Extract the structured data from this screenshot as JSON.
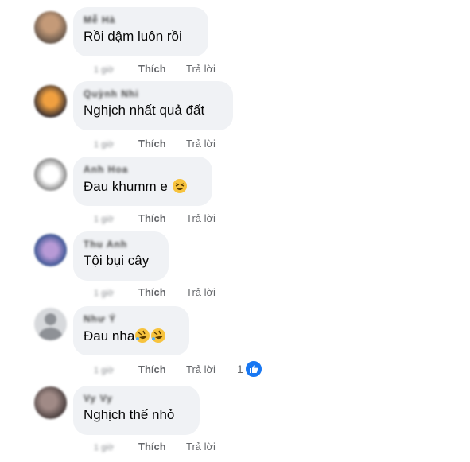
{
  "comments": [
    {
      "name": "Mễ Hà",
      "text": "Rồi dậm luôn rồi",
      "time": "1 giờ",
      "like_label": "Thích",
      "reply_label": "Trả lời"
    },
    {
      "name": "Quỳnh Nhi",
      "text": "Nghịch nhất quả đất",
      "time": "1 giờ",
      "like_label": "Thích",
      "reply_label": "Trả lời"
    },
    {
      "name": "Anh Hoa",
      "text": "Đau khumm e",
      "time": "1 giờ",
      "like_label": "Thích",
      "reply_label": "Trả lời",
      "emoji": "grinning-squint-emoji"
    },
    {
      "name": "Thu Anh",
      "text": "Tội bụi cây",
      "time": "1 giờ",
      "like_label": "Thích",
      "reply_label": "Trả lời"
    },
    {
      "name": "Như Ý",
      "text": "Đau nha",
      "time": "1 giờ",
      "like_label": "Thích",
      "reply_label": "Trả lời",
      "emoji": "rolling-laughing-emoji",
      "reaction_count": "1",
      "reaction_icon": "like-icon"
    },
    {
      "name": "Vy Vy",
      "text": "Nghịch thế nhỏ",
      "time": "1 giờ",
      "like_label": "Thích",
      "reply_label": "Trả lời"
    }
  ],
  "colors": {
    "bubble": "#f0f2f5",
    "secondary_text": "#65676b",
    "like_blue": "#1877f2"
  }
}
